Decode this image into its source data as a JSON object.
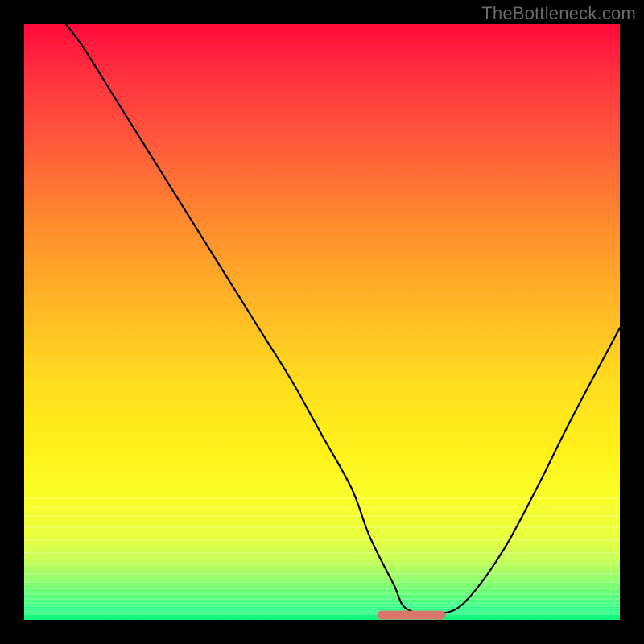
{
  "watermark": "TheBottleneck.com",
  "chart_data": {
    "type": "line",
    "title": "",
    "xlabel": "",
    "ylabel": "",
    "xlim": [
      0,
      100
    ],
    "ylim": [
      0,
      100
    ],
    "grid": false,
    "series": [
      {
        "name": "bottleneck-curve",
        "x": [
          7,
          10,
          15,
          20,
          25,
          30,
          35,
          40,
          45,
          50,
          55,
          58,
          62,
          64,
          68,
          70,
          74,
          80,
          86,
          92,
          100
        ],
        "y": [
          100,
          96,
          88,
          80,
          72,
          64,
          56,
          48,
          40,
          31,
          22,
          14,
          6,
          2,
          1,
          1,
          3,
          11,
          22,
          34,
          49
        ]
      },
      {
        "name": "optimal-range-marker",
        "x": [
          60,
          70
        ],
        "y": [
          0.8,
          0.8
        ]
      }
    ],
    "colors": {
      "curve": "#000000",
      "marker": "#d9786a",
      "background_top": "#ff0a3a",
      "background_bottom": "#10f57e"
    }
  }
}
